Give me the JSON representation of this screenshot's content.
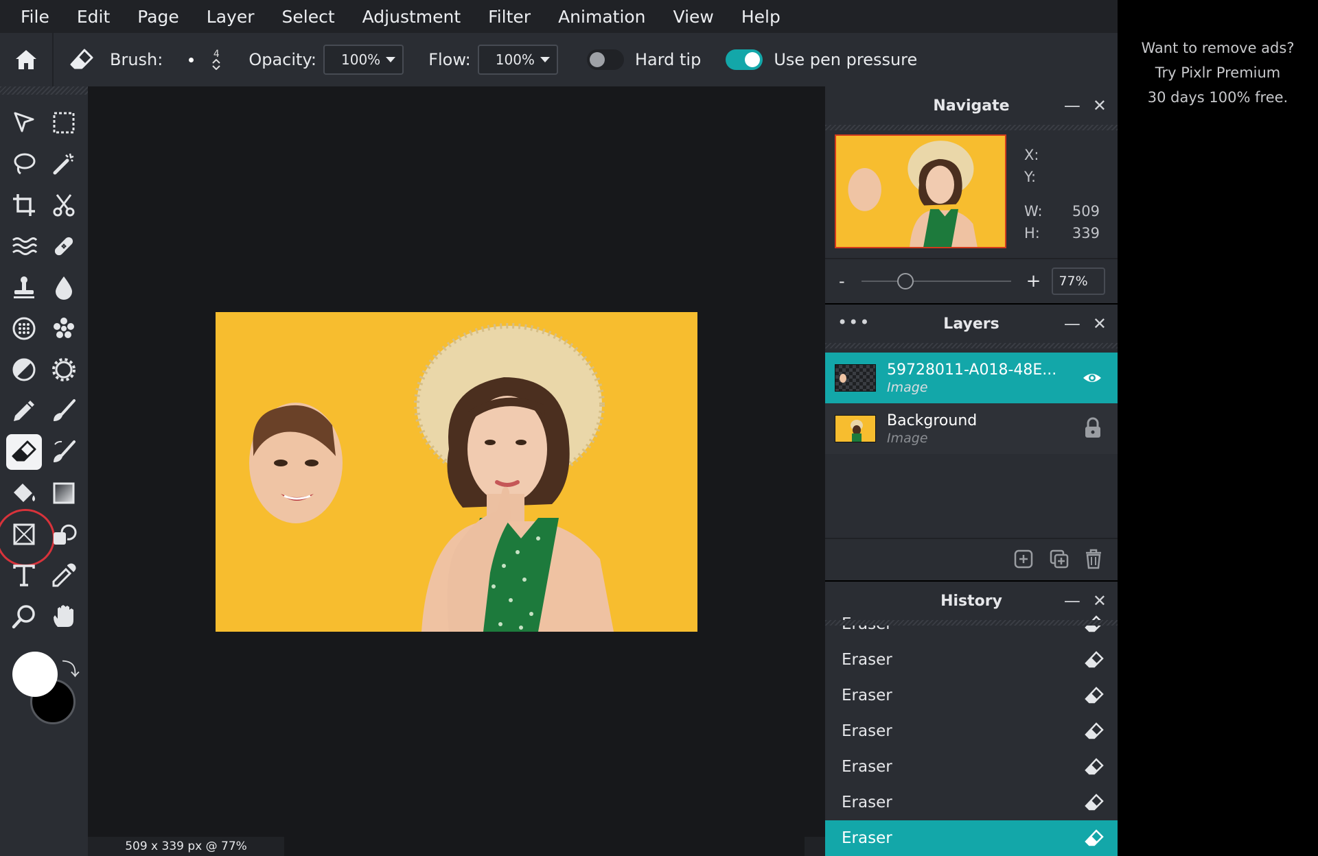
{
  "menu": [
    "File",
    "Edit",
    "Page",
    "Layer",
    "Select",
    "Adjustment",
    "Filter",
    "Animation",
    "View",
    "Help"
  ],
  "toolbar": {
    "brush_label": "Brush:",
    "brush_size": "4",
    "opacity_label": "Opacity:",
    "opacity_value": "100%",
    "flow_label": "Flow:",
    "flow_value": "100%",
    "hard_tip_label": "Hard tip",
    "hard_tip_on": false,
    "pen_pressure_label": "Use pen pressure",
    "pen_pressure_on": true
  },
  "tools": [
    "arrange-icon",
    "marquee-icon",
    "lasso-icon",
    "magic-wand-icon",
    "crop-icon",
    "cutout-icon",
    "liquify-icon",
    "heal-icon",
    "clone-stamp-icon",
    "blur-icon",
    "sponge-icon",
    "smudge-icon",
    "dodge-burn-icon",
    "filter-icon",
    "pencil-icon",
    "brush-icon",
    "eraser-icon",
    "color-replace-icon",
    "fill-icon",
    "gradient-icon",
    "shape-icon",
    "draw-icon",
    "text-icon",
    "eyedropper-icon",
    "zoom-icon",
    "hand-icon"
  ],
  "active_tool": "eraser-icon",
  "colors": {
    "foreground": "#ffffff",
    "background": "#000000",
    "accent": "#13a7a9",
    "canvas_bg": "#f7bd2f"
  },
  "status": "509 x 339 px @ 77%",
  "navigate": {
    "title": "Navigate",
    "x_label": "X:",
    "y_label": "Y:",
    "w_label": "W:",
    "w_value": "509",
    "h_label": "H:",
    "h_value": "339",
    "zoom_minus": "-",
    "zoom_plus": "+",
    "zoom_value": "77%"
  },
  "layers": {
    "title": "Layers",
    "items": [
      {
        "name": "59728011-A018-48E...",
        "type": "Image",
        "selected": true,
        "icon": "eye-icon"
      },
      {
        "name": "Background",
        "type": "Image",
        "selected": false,
        "icon": "lock-icon"
      }
    ]
  },
  "history": {
    "title": "History",
    "items": [
      "Eraser",
      "Eraser",
      "Eraser",
      "Eraser",
      "Eraser",
      "Eraser",
      "Eraser"
    ],
    "selected_index": 6
  },
  "ad": {
    "line1": "Want to remove ads?",
    "line2": "Try Pixlr Premium",
    "line3": "30 days 100% free."
  }
}
